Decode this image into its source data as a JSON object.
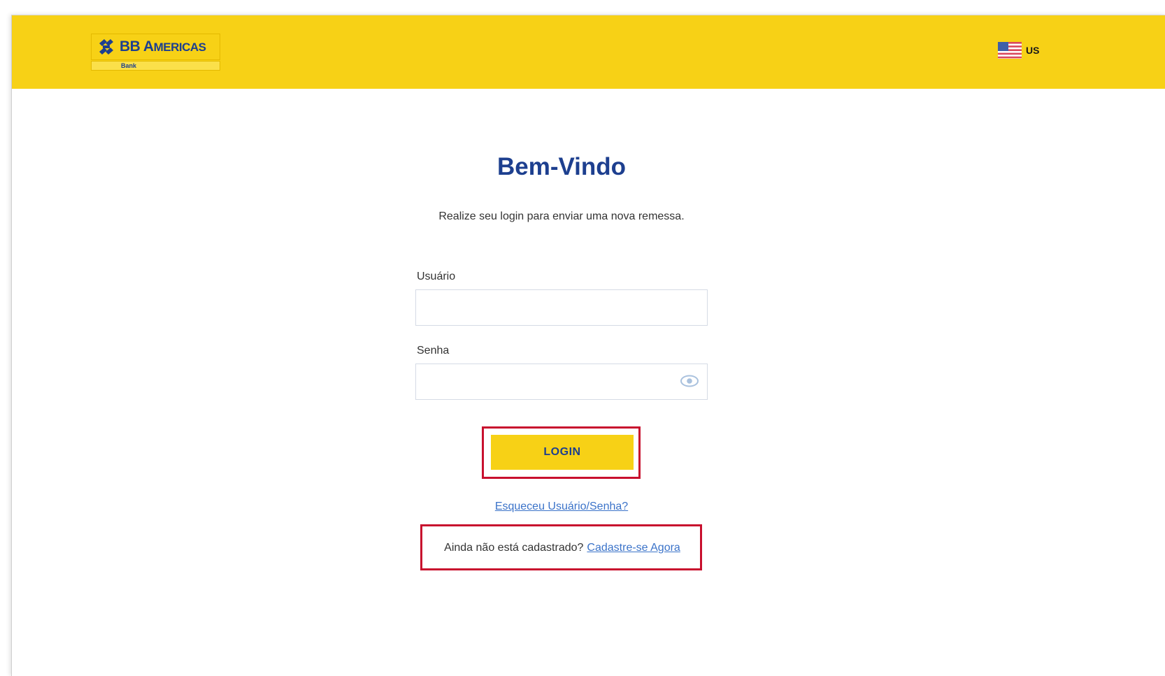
{
  "header": {
    "brand_name_big": "BB A",
    "brand_name_small": "MERICAS",
    "brand_sub": "Bank",
    "language": {
      "icon": "us-flag-icon",
      "label": "US"
    },
    "background_color": "#f7d116"
  },
  "main": {
    "title": "Bem-Vindo",
    "subtitle": "Realize seu login para enviar uma nova remessa.",
    "username": {
      "label": "Usuário",
      "value": "",
      "placeholder": ""
    },
    "password": {
      "label": "Senha",
      "value": "",
      "placeholder": "",
      "toggle_icon": "eye-icon"
    },
    "login_button": "LOGIN",
    "forgot_link": "Esqueceu Usuário/Senha?",
    "register_prompt": "Ainda não está cadastrado?",
    "register_link": "Cadastre-se Agora"
  },
  "colors": {
    "brand_yellow": "#f7d116",
    "brand_blue": "#1d3f8f",
    "link_blue": "#3b73c9",
    "highlight_red": "#c8102e"
  }
}
